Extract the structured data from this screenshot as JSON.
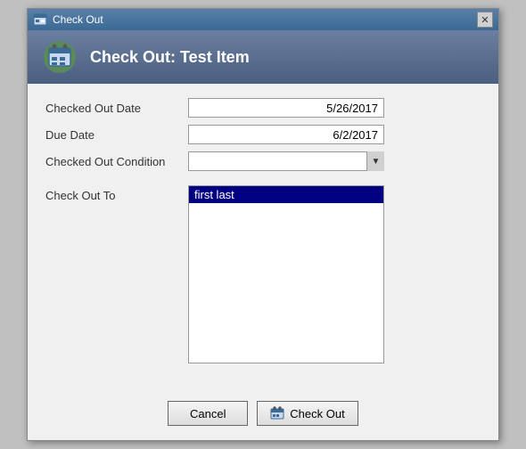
{
  "window": {
    "title": "Check Out",
    "dialog_title": "Check Out: Test Item"
  },
  "form": {
    "checked_out_date_label": "Checked Out Date",
    "checked_out_date_value": "5/26/2017",
    "due_date_label": "Due Date",
    "due_date_value": "6/2/2017",
    "checked_out_condition_label": "Checked Out Condition",
    "checked_out_condition_value": "",
    "checkout_to_label": "Check Out To",
    "checkout_to_selected": "first last"
  },
  "buttons": {
    "cancel_label": "Cancel",
    "checkout_label": "Check Out"
  }
}
